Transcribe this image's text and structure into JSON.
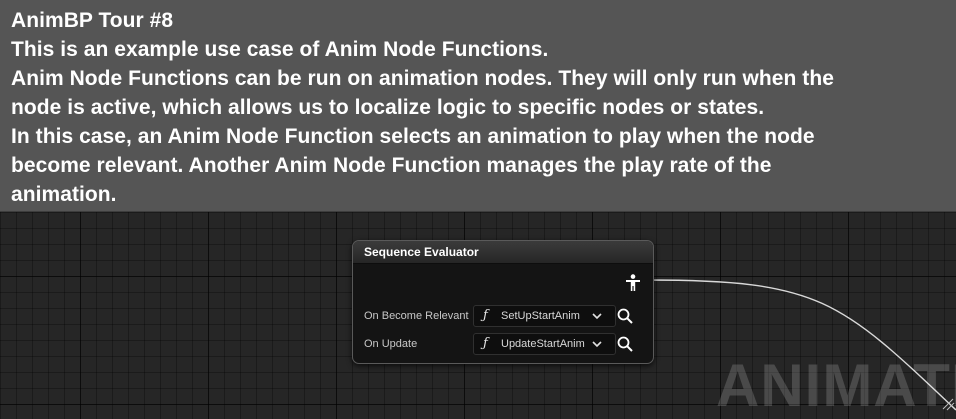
{
  "comment": {
    "lines": [
      "AnimBP Tour #8",
      "This is an example use case of Anim Node Functions.",
      "Anim Node Functions can be run on animation nodes. They will only run when the",
      "node is active, which allows us to localize logic to specific nodes or states.",
      "In this case, an Anim Node Function selects an animation to play when the node",
      "become relevant. Another Anim Node Function manages the play rate of the",
      "animation."
    ]
  },
  "node": {
    "title": "Sequence Evaluator",
    "pose_pin_icon": "person-pose-icon",
    "rows": [
      {
        "label": "On Become Relevant",
        "function": "SetUpStartAnim",
        "function_icon": "function-icon",
        "browse_icon": "search-icon"
      },
      {
        "label": "On Update",
        "function": "UpdateStartAnim",
        "function_icon": "function-icon",
        "browse_icon": "search-icon"
      }
    ]
  },
  "watermark": "ANIMATIC",
  "colors": {
    "graph_background": "#262626",
    "comment_background": "#555555",
    "node_body": "#141414",
    "wire": "#d9d9d9"
  }
}
